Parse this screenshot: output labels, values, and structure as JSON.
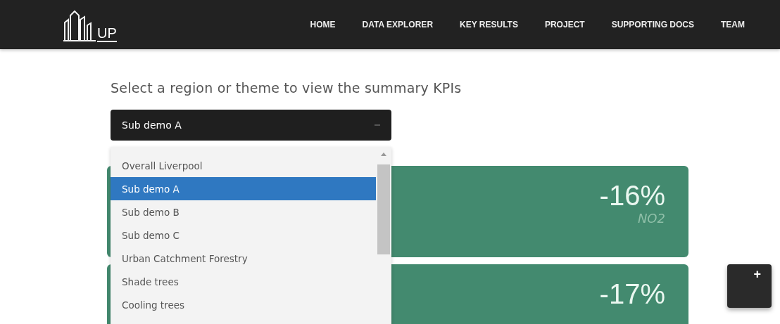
{
  "logo": {
    "big": "UP"
  },
  "nav": [
    {
      "label": "HOME"
    },
    {
      "label": "DATA EXPLORER"
    },
    {
      "label": "KEY RESULTS"
    },
    {
      "label": "PROJECT"
    },
    {
      "label": "SUPPORTING DOCS"
    },
    {
      "label": "TEAM"
    }
  ],
  "heading": "Select a region or theme to view the summary KPIs",
  "select": {
    "value": "Sub demo A",
    "expanded": true,
    "options": [
      {
        "label": "Overall Liverpool",
        "selected": false
      },
      {
        "label": "Sub demo A",
        "selected": true
      },
      {
        "label": "Sub demo B",
        "selected": false
      },
      {
        "label": "Sub demo C",
        "selected": false
      },
      {
        "label": "Urban Catchment Forestry",
        "selected": false
      },
      {
        "label": "Shade trees",
        "selected": false
      },
      {
        "label": "Cooling trees",
        "selected": false
      }
    ]
  },
  "cards": [
    {
      "value": "-16%",
      "caption": "NO2"
    },
    {
      "value": "-17%"
    }
  ],
  "fab": {
    "label": "+"
  }
}
